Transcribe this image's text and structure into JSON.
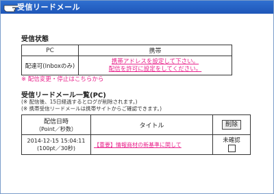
{
  "window": {
    "title": "受信リードメール"
  },
  "status": {
    "heading": "受信状態",
    "col_pc": "PC",
    "col_mobile": "携帯",
    "pc_value": "配達可(Inboxのみ)",
    "mobile_line1": "携帯アドレスを設定して下さい。",
    "mobile_line2": "配信を許可に設定をしてください。",
    "change_link": "※ 配信変更・停止はこちらから"
  },
  "list": {
    "heading": "受信リードメール一覧(PC)",
    "note1": "(※ 配信後、15日経過するとログが削除されます。)",
    "note2": "(※ 携帯受信リードメールは携帯サイトからご確認できます。)",
    "col_date_line1": "配信日時",
    "col_date_line2": "（Point／秒数）",
    "col_title": "タイトル",
    "delete_label": "削除",
    "rows": [
      {
        "date": "2014-12-15 15:04:11",
        "points": "(100pt／30秒)",
        "subject": "【重要】情報商材の新基準に関して",
        "status": "未確認"
      }
    ]
  }
}
